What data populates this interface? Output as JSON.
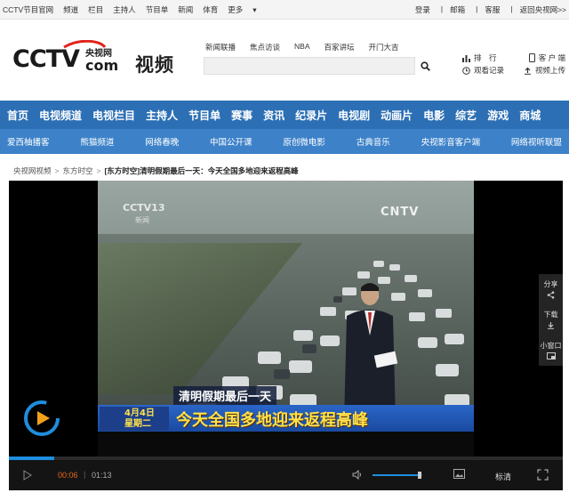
{
  "topbar": {
    "left": [
      "CCTV节目官网",
      "频道",
      "栏目",
      "主持人",
      "节目单",
      "新闻",
      "体育",
      "更多"
    ],
    "more_caret": "▾",
    "right": [
      "登录",
      "邮箱",
      "客服",
      "返回央视网>>"
    ]
  },
  "header": {
    "logo_brand": "CCTV",
    "logo_cn": "央视网",
    "logo_com": "com",
    "logo_suffix": "视频",
    "hotlinks": [
      "新闻联播",
      "焦点访谈",
      "NBA",
      "百家讲坛",
      "开门大吉"
    ],
    "search_placeholder": "",
    "tools": {
      "rank": "排　行",
      "client": "客 户 端",
      "history": "观看记录",
      "upload": "视频上传"
    }
  },
  "mainnav": [
    "首页",
    "电视频道",
    "电视栏目",
    "主持人",
    "节目单",
    "赛事",
    "资讯",
    "纪录片",
    "电视剧",
    "动画片",
    "电影",
    "综艺",
    "游戏",
    "商城"
  ],
  "subnav": [
    "爱西柚播客",
    "熊猫频道",
    "网络春晚",
    "中国公开课",
    "原创微电影",
    "古典音乐",
    "央视影音客户端",
    "网络视听联盟"
  ],
  "breadcrumb": {
    "items": [
      "央视网视频",
      "东方时空"
    ],
    "separator": ">",
    "current": "[东方时空]清明假期最后一天：今天全国多地迎来返程高峰"
  },
  "video": {
    "watermark_tl": "CCTV13",
    "watermark_tl_sub": "新闻",
    "watermark_tr": "CNTV",
    "caption_top": "清明假期最后一天",
    "caption_date_line1": "4月4日",
    "caption_date_line2": "星期二",
    "caption_main": "今天全国多地迎来返程高峰"
  },
  "side_tools": {
    "share": "分享",
    "download": "下载",
    "mini": "小窗口"
  },
  "controls": {
    "time_current": "00:06",
    "time_sep": "|",
    "time_total": "01:13",
    "quality": "标清",
    "progress_fraction": 0.082,
    "volume_fraction": 0.98
  },
  "colors": {
    "nav_blue": "#2c6fb5",
    "subnav_blue": "#3d82c9",
    "cctv_red": "#e0231c",
    "progress_blue": "#1e8ede",
    "time_orange": "#e86a1a",
    "caption_yellow": "#ffe24a"
  }
}
